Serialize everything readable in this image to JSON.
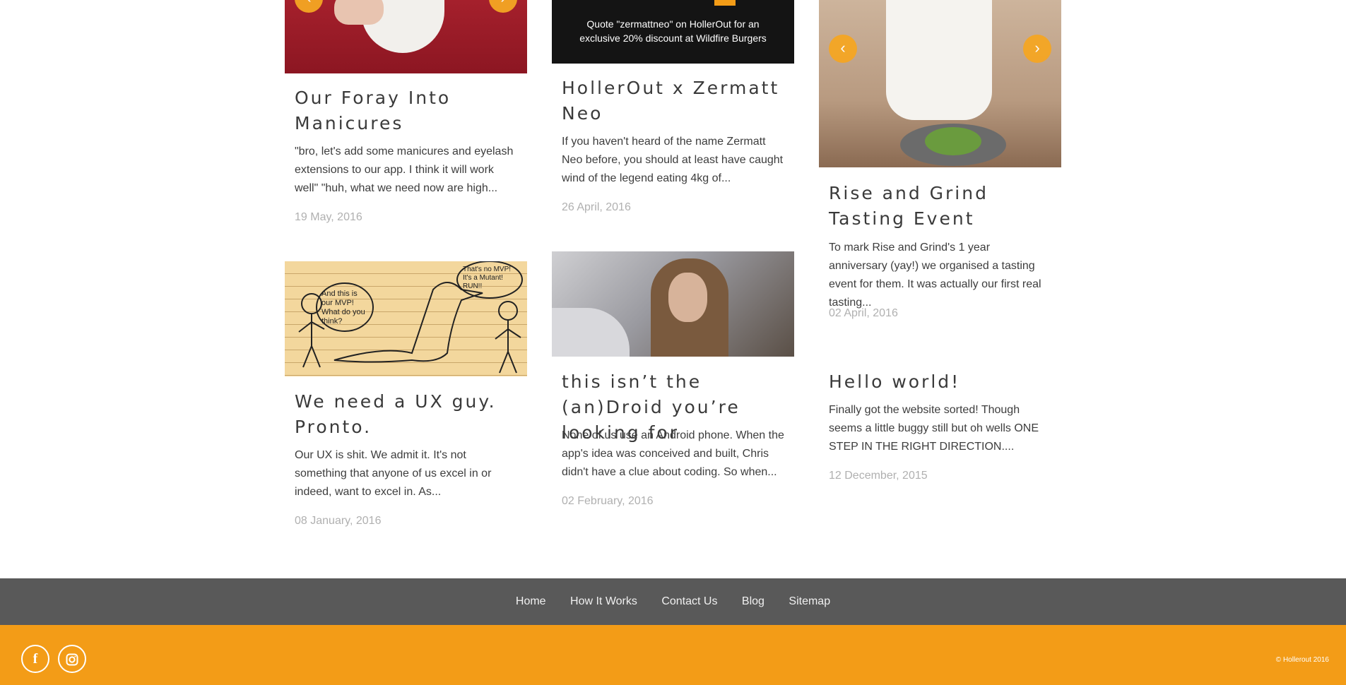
{
  "posts": [
    {
      "title": "Our Foray Into Manicures",
      "excerpt": "\"bro, let's add some manicures and eyelash extensions to our app. I think it will work well\" \"huh, what we need now are high...",
      "date": "19 May, 2016"
    },
    {
      "title": "HollerOut x Zermatt Neo",
      "excerpt": "If you haven't heard of the name Zermatt Neo before, you should at least have caught wind of the legend eating 4kg of...",
      "date": "26 April, 2016",
      "image_caption": "Quote \"zermattneo\" on HollerOut for an exclusive 20% discount at Wildfire Burgers"
    },
    {
      "title": "Rise and Grind Tasting Event",
      "excerpt": "To mark Rise and Grind's 1 year anniversary (yay!) we organised a tasting event for them. It was actually our first real tasting...",
      "date": "02 April, 2016"
    },
    {
      "title": "We need a UX guy. Pronto.",
      "excerpt": "Our UX is shit. We admit it. It's not something that anyone of us excel in or indeed, want to excel in. As...",
      "date": "08 January, 2016",
      "sketch_text": [
        "And this is our MVP! What do you think?",
        "That's no MVP! It's a Mutant! RUN!!"
      ]
    },
    {
      "title": "this isn’t the (an)Droid you’re looking for",
      "excerpt": "None of us use an Android phone. When the app's idea was conceived and built, Chris didn't have a clue about coding. So when...",
      "date": "02 February, 2016"
    },
    {
      "title": "Hello world!",
      "excerpt": "Finally got the website sorted! Though seems a little buggy still but oh wells ONE STEP IN THE RIGHT DIRECTION....",
      "date": "12 December, 2015"
    }
  ],
  "slider": {
    "prev_glyph": "‹",
    "next_glyph": "›"
  },
  "footer": {
    "nav": [
      "Home",
      "How It Works",
      "Contact Us",
      "Blog",
      "Sitemap"
    ],
    "social_icons": [
      "facebook-icon",
      "instagram-icon"
    ],
    "facebook_glyph": "f",
    "copyright": "© Hollerout 2016"
  },
  "colors": {
    "accent": "#f39c17",
    "footer_nav_bg": "#595959"
  }
}
